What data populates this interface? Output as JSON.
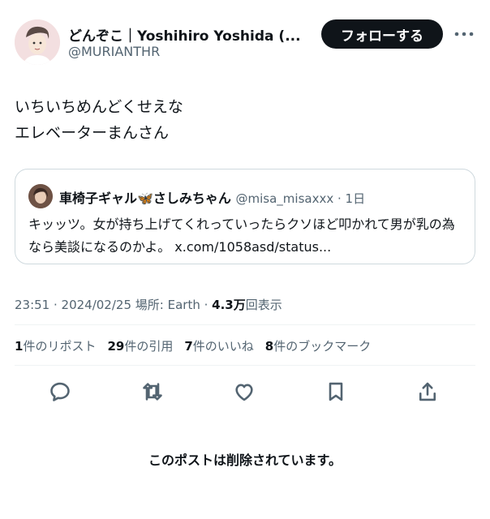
{
  "author": {
    "display_name": "どんぞこ｜Yoshihiro Yoshida (...",
    "handle": "@MURIANTHR"
  },
  "follow_button": "フォローする",
  "tweet_lines": [
    "いちいちめんどくせえな",
    "エレベーターまんさん"
  ],
  "quote": {
    "name": "車椅子ギャル🦋さしみちゃん",
    "handle_date": "@misa_misaxxx · 1日",
    "text": "キッッツ。女が持ち上げてくれっていったらクソほど叩かれて男が乳の為なら美談になるのかよ。 x.com/1058asd/status..."
  },
  "meta": {
    "time_date": "23:51 · 2024/02/25",
    "location": "場所: Earth",
    "views_number": "4.3万",
    "views_label": "回表示"
  },
  "stats": [
    {
      "count": "1",
      "label": "件のリポスト"
    },
    {
      "count": "29",
      "label": "件の引用"
    },
    {
      "count": "7",
      "label": "件のいいね"
    },
    {
      "count": "8",
      "label": "件のブックマーク"
    }
  ],
  "icons": [
    "reply-icon",
    "retweet-icon",
    "like-icon",
    "bookmark-icon",
    "share-icon",
    "more-icon"
  ],
  "deleted_notice": "このポストは削除されています。"
}
